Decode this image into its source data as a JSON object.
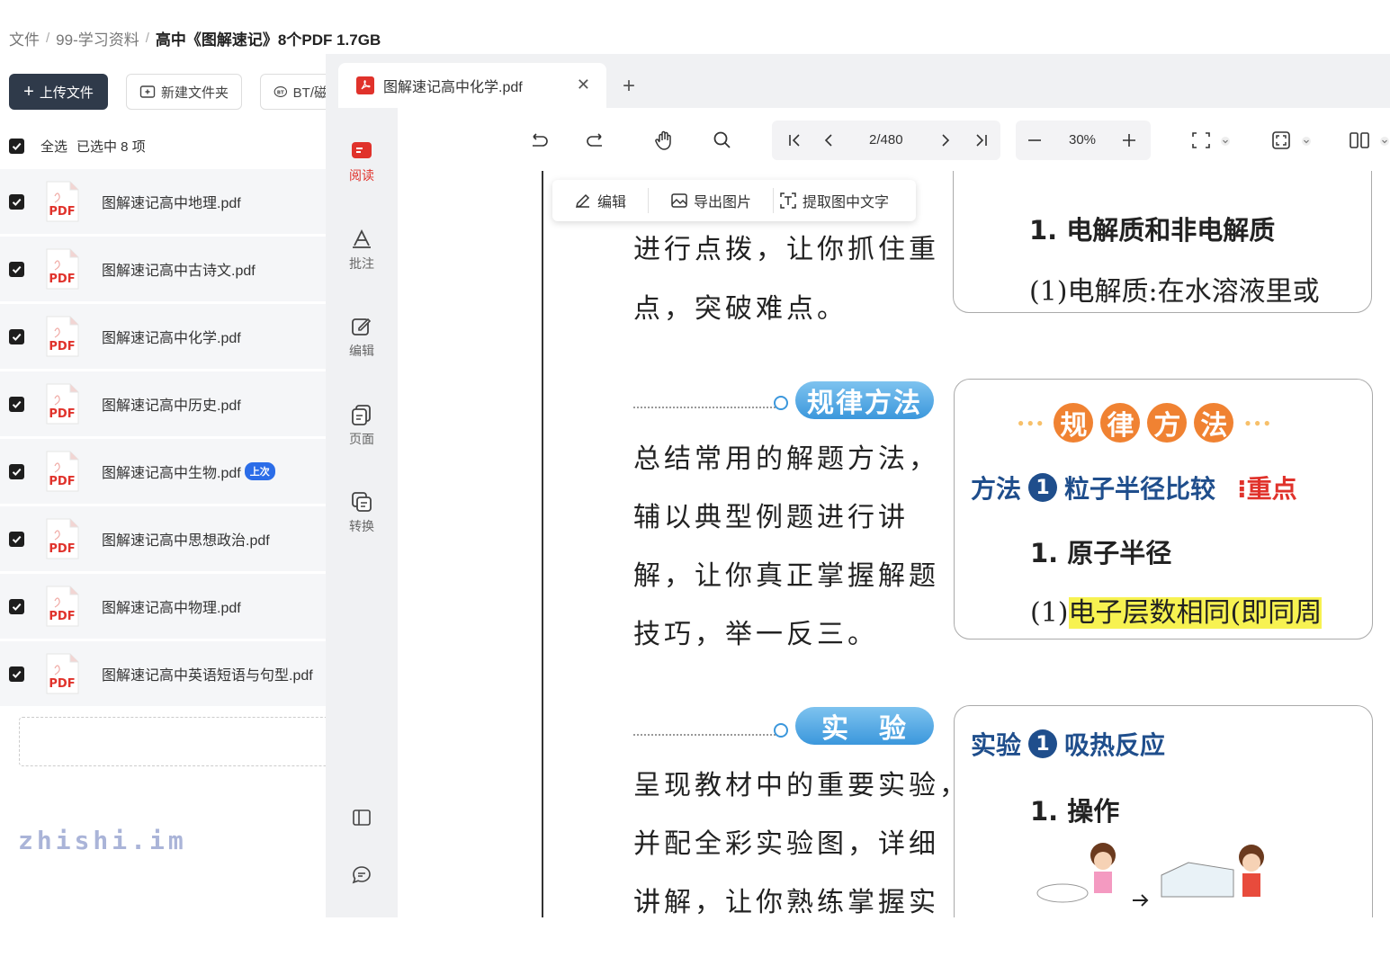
{
  "breadcrumb": {
    "root": "文件",
    "folder": "99-学习资料",
    "current": "高中《图解速记》8个PDF 1.7GB"
  },
  "toolbar": {
    "upload_label": "上传文件",
    "new_folder_label": "新建文件夹",
    "bt_label": "BT/磁"
  },
  "selection": {
    "select_all_label": "全选",
    "selected_text": "已选中 8 项"
  },
  "files": [
    {
      "name": "图解速记高中地理.pdf",
      "badge": ""
    },
    {
      "name": "图解速记高中古诗文.pdf",
      "badge": ""
    },
    {
      "name": "图解速记高中化学.pdf",
      "badge": ""
    },
    {
      "name": "图解速记高中历史.pdf",
      "badge": ""
    },
    {
      "name": "图解速记高中生物.pdf",
      "badge": "上次"
    },
    {
      "name": "图解速记高中思想政治.pdf",
      "badge": ""
    },
    {
      "name": "图解速记高中物理.pdf",
      "badge": ""
    },
    {
      "name": "图解速记高中英语短语与句型.pdf",
      "badge": ""
    }
  ],
  "pdf_icon_text": "PDF",
  "watermark": "zhishi.im",
  "viewer": {
    "tab_title": "图解速记高中化学.pdf",
    "sidebar": [
      {
        "label": "阅读",
        "icon": "book-icon"
      },
      {
        "label": "批注",
        "icon": "annotate-icon"
      },
      {
        "label": "编辑",
        "icon": "edit-icon"
      },
      {
        "label": "页面",
        "icon": "pages-icon"
      },
      {
        "label": "转换",
        "icon": "convert-icon"
      }
    ],
    "page_indicator": "2/480",
    "zoom": "30%",
    "context_menu": {
      "edit": "编辑",
      "export_image": "导出图片",
      "extract_text": "提取图中文字"
    }
  },
  "page_content": {
    "left_lines_top": [
      "进行点拨，让你抓住重",
      "点，突破难点。"
    ],
    "section1_pill": "规律方法",
    "section1_lines": [
      "总结常用的解题方法，",
      "辅以典型例题进行讲",
      "解，让你真正掌握解题",
      "技巧，举一反三。"
    ],
    "section2_pill": "实　验",
    "section2_lines": [
      "呈现教材中的重要实验，",
      "并配全彩实验图，详细",
      "讲解，让你熟练掌握实"
    ],
    "box1_title": "1. 电解质和非电解质",
    "box1_line": "(1)电解质:在水溶液里或",
    "box2_banner": [
      "规",
      "律",
      "方",
      "法"
    ],
    "box2_method_label": "方法",
    "box2_method_num": "1",
    "box2_method_title": "粒子半径比较",
    "box2_key": "重点",
    "box2_sub": "1. 原子半径",
    "box2_line_prefix": "(1)",
    "box2_line_hl": "电子层数相同(即同周",
    "box3_label": "实验",
    "box3_num": "1",
    "box3_title": "吸热反应",
    "box3_sub": "1. 操作"
  }
}
